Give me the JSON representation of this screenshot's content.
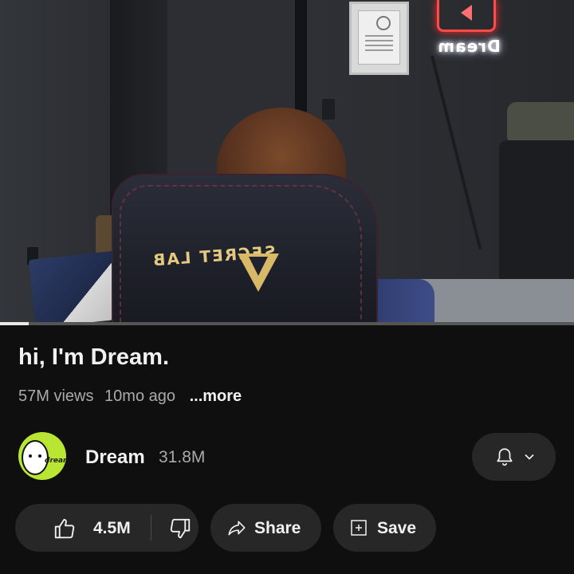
{
  "video": {
    "progress_fraction": 0.05,
    "chair_brand_text": "SECRET LAB",
    "neon_sign_text": "Dream"
  },
  "info": {
    "title": "hi, I'm Dream.",
    "views": "57M views",
    "age": "10mo ago",
    "more_label": "...more"
  },
  "channel": {
    "name": "Dream",
    "subscribers": "31.8M",
    "avatar_text": "dream",
    "avatar_color": "#b9e533",
    "bell_icon": "bell-icon",
    "chevron_icon": "chevron-down-icon"
  },
  "actions": {
    "like_count": "4.5M",
    "share_label": "Share",
    "save_label": "Save"
  },
  "colors": {
    "background": "#0f0f0f",
    "pill": "#272727",
    "primary_text": "#f1f1f1",
    "secondary_text": "#aaaaaa"
  }
}
